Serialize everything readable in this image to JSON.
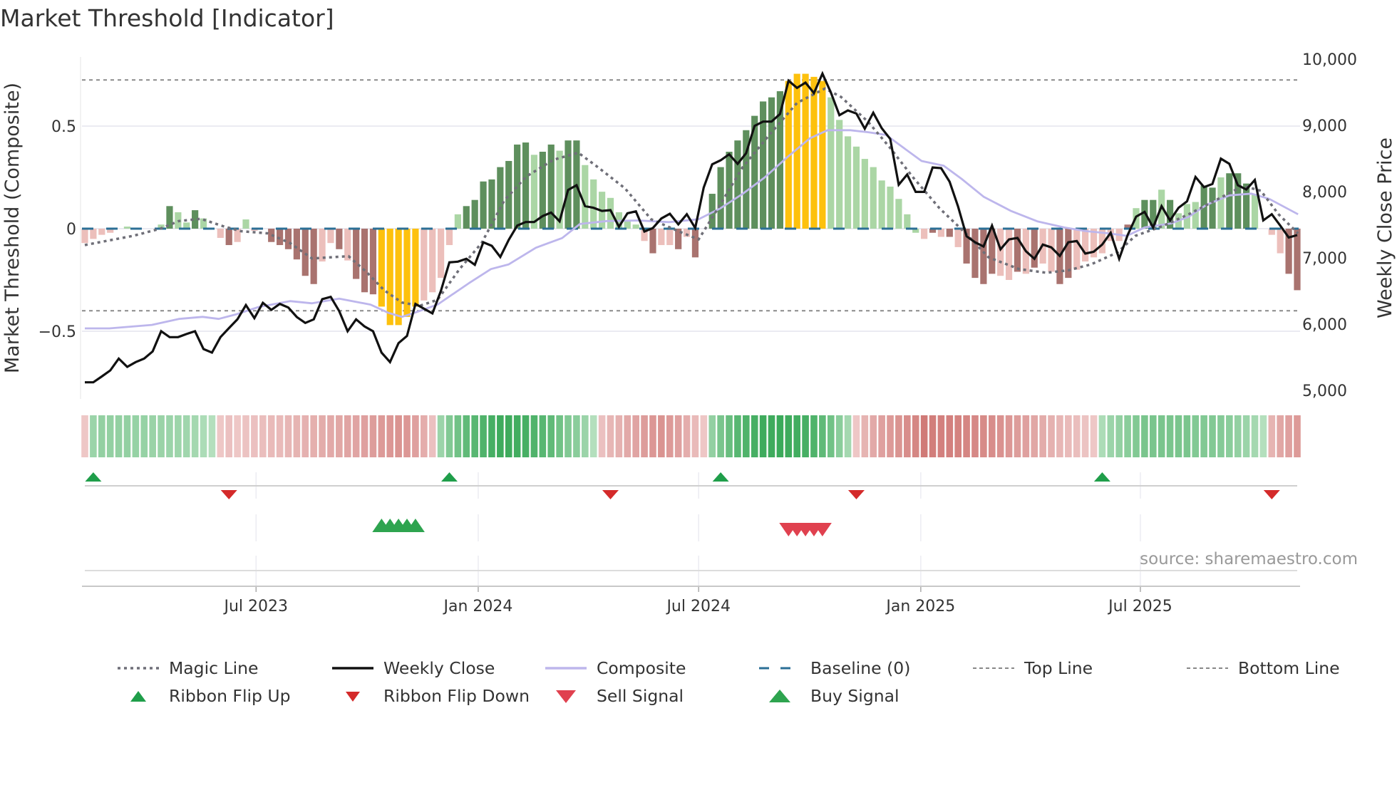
{
  "title": "Market Threshold [Indicator]",
  "chart_data": {
    "type": "bar",
    "title": "Market Threshold [Indicator]",
    "weeks": 144,
    "left_axis": {
      "label": "Market Threshold (Composite)",
      "ticks": [
        {
          "v": 0.5,
          "label": "0.5"
        },
        {
          "v": 0,
          "label": "0"
        },
        {
          "v": -0.5,
          "label": "−0.5"
        }
      ]
    },
    "right_axis": {
      "label": "Weekly Close Price",
      "ticks": [
        {
          "v": 10000,
          "label": "10,000"
        },
        {
          "v": 9000,
          "label": "9,000"
        },
        {
          "v": 8000,
          "label": "8,000"
        },
        {
          "v": 7000,
          "label": "7,000"
        },
        {
          "v": 6000,
          "label": "6,000"
        },
        {
          "v": 5000,
          "label": "5,000"
        }
      ]
    },
    "x_axis": {
      "ticks": [
        {
          "week": 20.2,
          "label": "Jul 2023"
        },
        {
          "week": 46.4,
          "label": "Jan 2024"
        },
        {
          "week": 72.4,
          "label": "Jul 2024"
        },
        {
          "week": 98.6,
          "label": "Jan 2025"
        },
        {
          "week": 124.5,
          "label": "Jul 2025"
        }
      ]
    },
    "baseline": 0,
    "top_line": 0.725,
    "bottom_line": -0.4,
    "histogram": {
      "values": [
        -0.07,
        -0.05,
        -0.03,
        -0.02,
        0,
        0.01,
        0,
        0,
        0,
        0.02,
        0.11,
        0.08,
        0.03,
        0.09,
        0.05,
        0,
        -0.045,
        -0.08,
        -0.065,
        0.045,
        -0.01,
        0,
        -0.065,
        -0.08,
        -0.1,
        -0.15,
        -0.23,
        -0.27,
        -0.16,
        -0.07,
        -0.1,
        -0.155,
        -0.245,
        -0.31,
        -0.32,
        -0.38,
        -0.47,
        -0.47,
        -0.43,
        -0.38,
        -0.35,
        -0.31,
        -0.24,
        -0.08,
        0.07,
        0.11,
        0.14,
        0.23,
        0.24,
        0.3,
        0.33,
        0.41,
        0.42,
        0.36,
        0.375,
        0.41,
        0.38,
        0.43,
        0.43,
        0.31,
        0.24,
        0.18,
        0.15,
        0.08,
        0.04,
        0.02,
        -0.06,
        -0.12,
        -0.08,
        -0.08,
        -0.1,
        -0.04,
        -0.14,
        0,
        0.17,
        0.3,
        0.375,
        0.43,
        0.48,
        0.55,
        0.62,
        0.64,
        0.67,
        0.72,
        0.755,
        0.755,
        0.74,
        0.72,
        0.64,
        0.53,
        0.45,
        0.4,
        0.34,
        0.3,
        0.235,
        0.205,
        0.145,
        0.07,
        -0.02,
        -0.05,
        -0.02,
        -0.04,
        -0.04,
        -0.09,
        -0.17,
        -0.24,
        -0.27,
        -0.22,
        -0.23,
        -0.25,
        -0.21,
        -0.22,
        -0.19,
        -0.17,
        -0.21,
        -0.27,
        -0.24,
        -0.2,
        -0.16,
        -0.14,
        -0.12,
        -0.06,
        -0.06,
        0.02,
        0.1,
        0.14,
        0.14,
        0.19,
        0.14,
        0.075,
        0.12,
        0.13,
        0.21,
        0.2,
        0.25,
        0.27,
        0.27,
        0.22,
        0.17,
        0,
        -0.03,
        -0.12,
        -0.22,
        -0.3
      ],
      "codes": "rrrrggggggGggGggrRrgrgRRRRRRrrRrRRRYYYYYrrrrgGGGGGGGGgGGgGGgggggggrRrrRrRgGGGGGGGGGYYYYYgggggggggggrRrRrRRRRrrRrRrrRRrrrrrrRgGGgGgggGGgGGGggrrRRR",
      "legend_codes": {
        "G": "rising positive",
        "g": "falling positive",
        "R": "falling negative",
        "r": "rising negative",
        "Y": "extreme"
      }
    },
    "weekly_close": [
      5122,
      5122,
      5210,
      5301,
      5480,
      5355,
      5427,
      5480,
      5588,
      5893,
      5803,
      5803,
      5850,
      5893,
      5624,
      5570,
      5803,
      5940,
      6072,
      6287,
      6090,
      6322,
      6215,
      6305,
      6251,
      6108,
      6018,
      6072,
      6376,
      6412,
      6197,
      5893,
      6072,
      5964,
      5893,
      5570,
      5427,
      5713,
      5821,
      6305,
      6233,
      6161,
      6502,
      6932,
      6943,
      6986,
      6896,
      7236,
      7182,
      7014,
      7272,
      7487,
      7541,
      7541,
      7631,
      7684,
      7552,
      8025,
      8097,
      7781,
      7756,
      7709,
      7720,
      7469,
      7673,
      7702,
      7398,
      7451,
      7595,
      7666,
      7505,
      7659,
      7451,
      8061,
      8412,
      8473,
      8563,
      8419,
      8580,
      8993,
      9057,
      9057,
      9172,
      9674,
      9566,
      9645,
      9487,
      9781,
      9494,
      9154,
      9226,
      9179,
      8950,
      9190,
      8957,
      8796,
      8104,
      8258,
      7996,
      7996,
      8365,
      8355,
      8150,
      7774,
      7326,
      7236,
      7172,
      7487,
      7129,
      7279,
      7301,
      7100,
      6986,
      7201,
      7158,
      7029,
      7236,
      7254,
      7064,
      7093,
      7201,
      7380,
      6986,
      7344,
      7623,
      7695,
      7459,
      7781,
      7566,
      7756,
      7853,
      8222,
      8068,
      8115,
      8498,
      8419,
      8097,
      8032,
      8175,
      7566,
      7659,
      7487,
      7308,
      7344
    ],
    "composite": [
      [
        0,
        -0.486
      ],
      [
        2.9,
        -0.486
      ],
      [
        7.9,
        -0.469
      ],
      [
        11.1,
        -0.44
      ],
      [
        13.9,
        -0.43
      ],
      [
        15.8,
        -0.44
      ],
      [
        17.9,
        -0.417
      ],
      [
        20.5,
        -0.382
      ],
      [
        24.2,
        -0.353
      ],
      [
        26.8,
        -0.364
      ],
      [
        30,
        -0.341
      ],
      [
        33.7,
        -0.37
      ],
      [
        35.8,
        -0.41
      ],
      [
        37.4,
        -0.43
      ],
      [
        38.9,
        -0.41
      ],
      [
        41.6,
        -0.37
      ],
      [
        45.3,
        -0.266
      ],
      [
        47.9,
        -0.197
      ],
      [
        50,
        -0.174
      ],
      [
        53.2,
        -0.093
      ],
      [
        56.3,
        -0.046
      ],
      [
        58.4,
        0.023
      ],
      [
        61.6,
        0.037
      ],
      [
        65.3,
        0.04
      ],
      [
        68.9,
        0.032
      ],
      [
        72.4,
        0.046
      ],
      [
        75,
        0.1
      ],
      [
        77.6,
        0.17
      ],
      [
        80.2,
        0.25
      ],
      [
        82.9,
        0.35
      ],
      [
        85.5,
        0.44
      ],
      [
        87.6,
        0.48
      ],
      [
        90.3,
        0.48
      ],
      [
        92.4,
        0.47
      ],
      [
        94.5,
        0.457
      ],
      [
        96.6,
        0.393
      ],
      [
        98.7,
        0.33
      ],
      [
        101.3,
        0.307
      ],
      [
        103.4,
        0.243
      ],
      [
        106,
        0.156
      ],
      [
        109.2,
        0.087
      ],
      [
        112.4,
        0.035
      ],
      [
        115.5,
        0.006
      ],
      [
        118.1,
        -0.012
      ],
      [
        120.8,
        -0.023
      ],
      [
        122.9,
        -0.035
      ],
      [
        125,
        0.006
      ],
      [
        128.1,
        0.025
      ],
      [
        130.2,
        0.058
      ],
      [
        132.3,
        0.116
      ],
      [
        135,
        0.162
      ],
      [
        137.6,
        0.171
      ],
      [
        139.7,
        0.145
      ],
      [
        143.1,
        0.07
      ]
    ],
    "magic_line": [
      [
        0,
        -0.08
      ],
      [
        5.8,
        -0.034
      ],
      [
        8.9,
        0
      ],
      [
        11.1,
        0.037
      ],
      [
        13.7,
        0.048
      ],
      [
        16.3,
        0.012
      ],
      [
        18.4,
        -0.012
      ],
      [
        21.6,
        -0.023
      ],
      [
        24.2,
        -0.07
      ],
      [
        26.8,
        -0.145
      ],
      [
        28.9,
        -0.14
      ],
      [
        31.1,
        -0.134
      ],
      [
        33.2,
        -0.21
      ],
      [
        35.3,
        -0.3
      ],
      [
        37.4,
        -0.36
      ],
      [
        39.5,
        -0.376
      ],
      [
        41.6,
        -0.347
      ],
      [
        44.2,
        -0.197
      ],
      [
        46.8,
        -0.07
      ],
      [
        49.5,
        0.139
      ],
      [
        52.1,
        0.255
      ],
      [
        55.3,
        0.336
      ],
      [
        58.2,
        0.37
      ],
      [
        60.5,
        0.3
      ],
      [
        63.7,
        0.197
      ],
      [
        66.8,
        0.046
      ],
      [
        70,
        -0.012
      ],
      [
        72.4,
        -0.052
      ],
      [
        74.5,
        0.087
      ],
      [
        77.6,
        0.3
      ],
      [
        80.8,
        0.46
      ],
      [
        84,
        0.613
      ],
      [
        87.3,
        0.683
      ],
      [
        89.2,
        0.642
      ],
      [
        92.4,
        0.52
      ],
      [
        95,
        0.393
      ],
      [
        97.6,
        0.254
      ],
      [
        100.8,
        0.1
      ],
      [
        103.9,
        -0.023
      ],
      [
        106.6,
        -0.14
      ],
      [
        110.2,
        -0.197
      ],
      [
        113.4,
        -0.215
      ],
      [
        116,
        -0.203
      ],
      [
        118.7,
        -0.174
      ],
      [
        121.8,
        -0.116
      ],
      [
        123.9,
        -0.035
      ],
      [
        127.1,
        0.012
      ],
      [
        130.2,
        0.07
      ],
      [
        133.4,
        0.139
      ],
      [
        136.6,
        0.208
      ],
      [
        138.7,
        0.185
      ],
      [
        140.8,
        0.07
      ],
      [
        143.1,
        -0.023
      ]
    ],
    "ribbon": [
      -0.15,
      0.35,
      0.4,
      0.4,
      0.4,
      0.4,
      0.38,
      0.38,
      0.36,
      0.36,
      0.35,
      0.34,
      0.32,
      0.3,
      0.25,
      0.2,
      -0.15,
      -0.2,
      -0.15,
      -0.18,
      -0.2,
      -0.22,
      -0.25,
      -0.25,
      -0.28,
      -0.3,
      -0.32,
      -0.33,
      -0.36,
      -0.38,
      -0.4,
      -0.42,
      -0.42,
      -0.45,
      -0.48,
      -0.5,
      -0.52,
      -0.55,
      -0.52,
      -0.45,
      -0.35,
      -0.2,
      0.35,
      0.5,
      0.6,
      0.7,
      0.75,
      0.8,
      0.85,
      0.9,
      0.9,
      0.88,
      0.85,
      0.8,
      0.75,
      0.7,
      0.6,
      0.5,
      0.45,
      0.35,
      0.2,
      -0.2,
      -0.28,
      -0.32,
      -0.38,
      -0.42,
      -0.48,
      -0.52,
      -0.55,
      -0.5,
      -0.45,
      -0.35,
      -0.25,
      -0.15,
      0.4,
      0.55,
      0.65,
      0.75,
      0.8,
      0.85,
      0.9,
      0.9,
      0.92,
      0.9,
      0.88,
      0.85,
      0.8,
      0.7,
      0.6,
      0.45,
      0.3,
      -0.15,
      -0.3,
      -0.38,
      -0.45,
      -0.5,
      -0.55,
      -0.6,
      -0.65,
      -0.75,
      -0.72,
      -0.7,
      -0.7,
      -0.68,
      -0.66,
      -0.64,
      -0.62,
      -0.6,
      -0.56,
      -0.52,
      -0.48,
      -0.45,
      -0.4,
      -0.36,
      -0.32,
      -0.28,
      -0.25,
      -0.22,
      -0.18,
      -0.15,
      0.25,
      0.35,
      0.4,
      0.45,
      0.5,
      0.55,
      0.55,
      0.55,
      0.55,
      0.55,
      0.55,
      0.5,
      0.5,
      0.5,
      0.48,
      0.45,
      0.4,
      0.35,
      0.3,
      0.2,
      -0.3,
      -0.4,
      -0.45,
      -0.5
    ],
    "ribbon_flip_up": [
      1,
      43,
      75,
      120
    ],
    "ribbon_flip_down": [
      17,
      62,
      91,
      140
    ],
    "buy_signals": [
      35,
      36,
      37,
      38,
      39
    ],
    "sell_signals": [
      83,
      84,
      85,
      86,
      87
    ],
    "source": "source: sharemaestro.com",
    "legend": [
      {
        "label": "Magic Line"
      },
      {
        "label": "Weekly Close"
      },
      {
        "label": "Composite"
      },
      {
        "label": "Baseline (0)"
      },
      {
        "label": "Top Line"
      },
      {
        "label": "Bottom Line"
      },
      {
        "label": "Ribbon Flip Up"
      },
      {
        "label": "Ribbon Flip Down"
      },
      {
        "label": "Sell Signal"
      },
      {
        "label": "Buy Signal"
      }
    ],
    "colors": {
      "G": "#5e8f5d",
      "g": "#abd6a5",
      "R": "#a9736f",
      "r": "#ecbfbb",
      "Y": "#fdc10d",
      "close": "#111111",
      "composite": "#bdb6ec",
      "magic": "#6f6f78",
      "baseline": "#2b6f96",
      "flip_up": "#1f9e4a",
      "flip_down": "#d42a2a",
      "buy": "#2ea44f",
      "sell": "#e0414f"
    }
  }
}
